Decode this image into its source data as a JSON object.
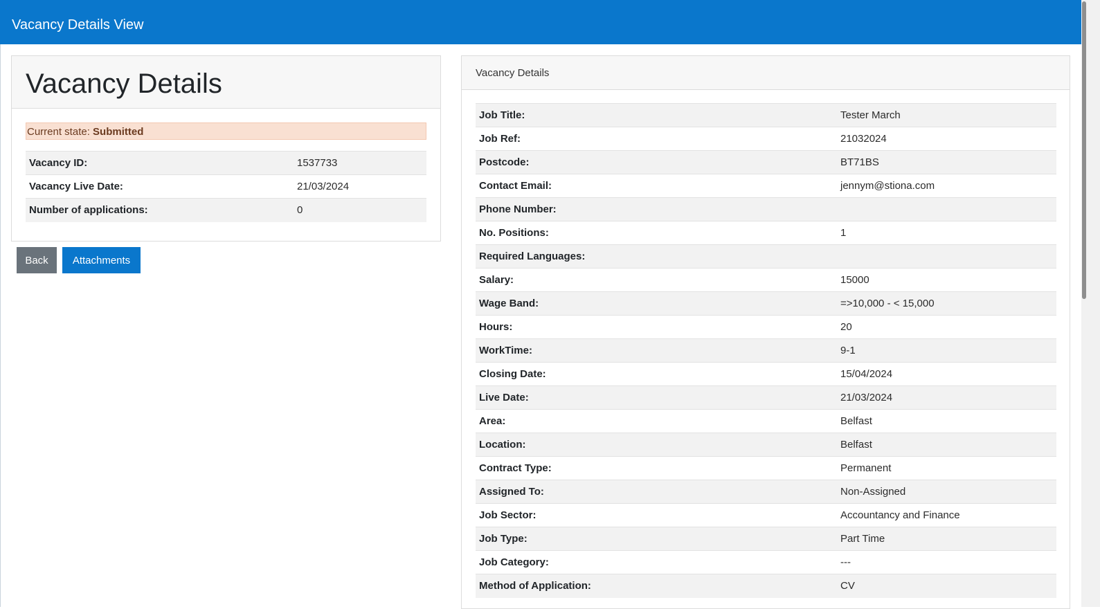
{
  "navbar": {
    "title": "Vacancy Details View"
  },
  "summary": {
    "heading": "Vacancy Details",
    "state_label": "Current state: ",
    "state_value": "Submitted",
    "rows": [
      {
        "label": "Vacancy ID:",
        "value": "1537733"
      },
      {
        "label": "Vacancy Live Date:",
        "value": "21/03/2024"
      },
      {
        "label": "Number of applications:",
        "value": "0"
      }
    ]
  },
  "buttons": {
    "back": "Back",
    "attachments": "Attachments"
  },
  "details": {
    "header": "Vacancy Details",
    "rows": [
      {
        "label": "Job Title:",
        "value": "Tester March"
      },
      {
        "label": "Job Ref:",
        "value": "21032024"
      },
      {
        "label": "Postcode:",
        "value": "BT71BS"
      },
      {
        "label": "Contact Email:",
        "value": "jennym@stiona.com"
      },
      {
        "label": "Phone Number:",
        "value": ""
      },
      {
        "label": "No. Positions:",
        "value": "1"
      },
      {
        "label": "Required Languages:",
        "value": ""
      },
      {
        "label": "Salary:",
        "value": "15000"
      },
      {
        "label": "Wage Band:",
        "value": "=>10,000 - < 15,000"
      },
      {
        "label": "Hours:",
        "value": "20"
      },
      {
        "label": "WorkTime:",
        "value": "9-1"
      },
      {
        "label": "Closing Date:",
        "value": "15/04/2024"
      },
      {
        "label": "Live Date:",
        "value": "21/03/2024"
      },
      {
        "label": "Area:",
        "value": "Belfast"
      },
      {
        "label": "Location:",
        "value": "Belfast"
      },
      {
        "label": "Contract Type:",
        "value": "Permanent"
      },
      {
        "label": "Assigned To:",
        "value": "Non-Assigned"
      },
      {
        "label": "Job Sector:",
        "value": "Accountancy and Finance"
      },
      {
        "label": "Job Type:",
        "value": "Part Time"
      },
      {
        "label": "Job Category:",
        "value": "---"
      },
      {
        "label": "Method of Application:",
        "value": "CV"
      }
    ]
  },
  "colors": {
    "brand": "#0a77cc",
    "state_bg": "#f9e0d2",
    "back_button": "#6a737b"
  }
}
